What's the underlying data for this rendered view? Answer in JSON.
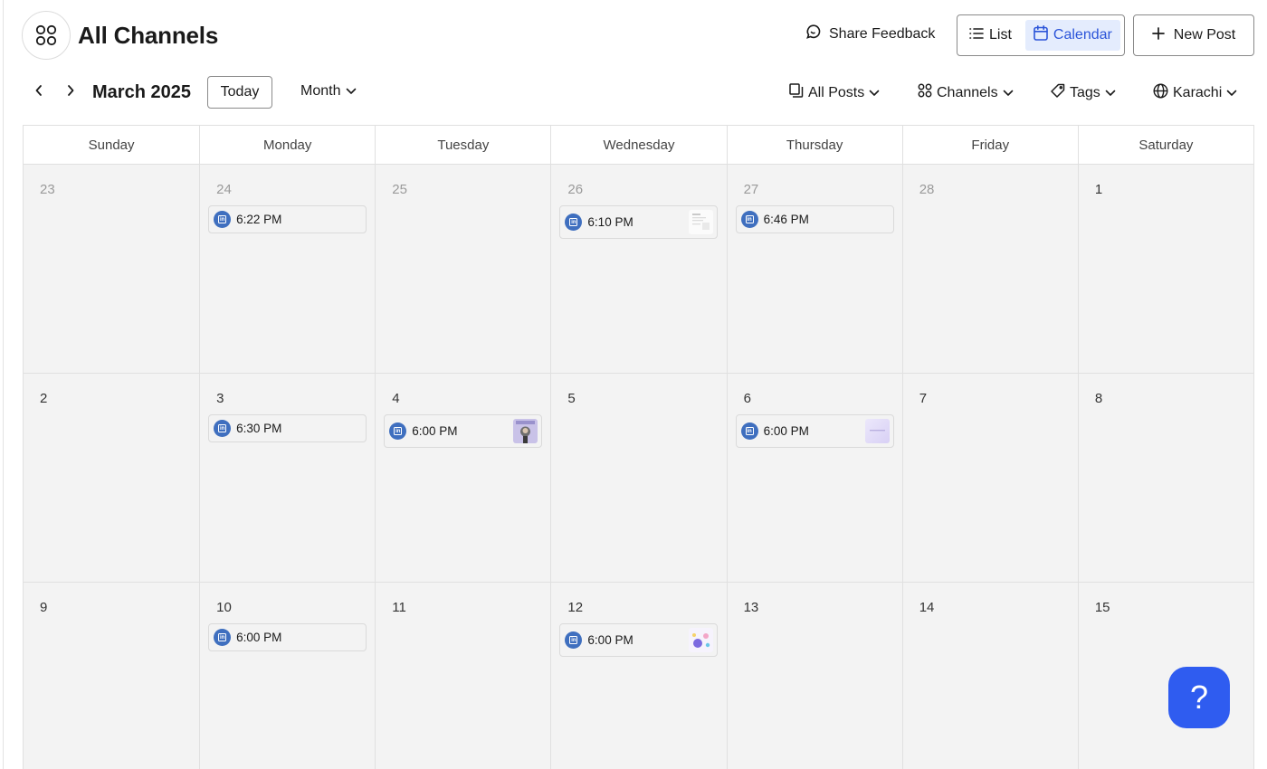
{
  "header": {
    "title": "All Channels",
    "app_icon": "channels-grid-icon",
    "share_feedback": "Share Feedback",
    "view_list": "List",
    "view_calendar": "Calendar",
    "active_view": "Calendar",
    "new_post": "New Post"
  },
  "toolbar": {
    "month_label": "March 2025",
    "today": "Today",
    "view_mode": "Month",
    "filter_posts": "All Posts",
    "filter_channels": "Channels",
    "filter_tags": "Tags",
    "timezone": "Karachi"
  },
  "calendar": {
    "weekdays": [
      "Sunday",
      "Monday",
      "Tuesday",
      "Wednesday",
      "Thursday",
      "Friday",
      "Saturday"
    ],
    "weeks": [
      [
        {
          "day": "23",
          "other": true,
          "posts": []
        },
        {
          "day": "24",
          "other": true,
          "posts": [
            {
              "time": "6:22 PM",
              "channel": "linkedin",
              "thumb": false
            }
          ]
        },
        {
          "day": "25",
          "other": true,
          "posts": []
        },
        {
          "day": "26",
          "other": true,
          "posts": [
            {
              "time": "6:10 PM",
              "channel": "linkedin",
              "thumb": "doc"
            }
          ]
        },
        {
          "day": "27",
          "other": true,
          "posts": [
            {
              "time": "6:46 PM",
              "channel": "linkedin",
              "thumb": false
            }
          ]
        },
        {
          "day": "28",
          "other": true,
          "posts": []
        },
        {
          "day": "1",
          "other": false,
          "posts": []
        }
      ],
      [
        {
          "day": "2",
          "other": false,
          "posts": []
        },
        {
          "day": "3",
          "other": false,
          "posts": [
            {
              "time": "6:30 PM",
              "channel": "linkedin",
              "thumb": false
            }
          ]
        },
        {
          "day": "4",
          "other": false,
          "posts": [
            {
              "time": "6:00 PM",
              "channel": "linkedin",
              "thumb": "person"
            }
          ]
        },
        {
          "day": "5",
          "other": false,
          "posts": []
        },
        {
          "day": "6",
          "other": false,
          "posts": [
            {
              "time": "6:00 PM",
              "channel": "linkedin",
              "thumb": "gradient"
            }
          ]
        },
        {
          "day": "7",
          "other": false,
          "posts": []
        },
        {
          "day": "8",
          "other": false,
          "posts": []
        }
      ],
      [
        {
          "day": "9",
          "other": false,
          "posts": []
        },
        {
          "day": "10",
          "other": false,
          "posts": [
            {
              "time": "6:00 PM",
              "channel": "linkedin",
              "thumb": false
            }
          ]
        },
        {
          "day": "11",
          "other": false,
          "posts": []
        },
        {
          "day": "12",
          "other": false,
          "posts": [
            {
              "time": "6:00 PM",
              "channel": "linkedin",
              "thumb": "colorful"
            }
          ]
        },
        {
          "day": "13",
          "other": false,
          "posts": []
        },
        {
          "day": "14",
          "other": false,
          "posts": []
        },
        {
          "day": "15",
          "other": false,
          "posts": []
        }
      ]
    ]
  },
  "help": {
    "label": "?",
    "icon": "help-icon"
  },
  "colors": {
    "accent": "#2f5cf0",
    "linkedin": "#3f6fbf",
    "active_view_bg": "#e4ecfd",
    "cell_bg": "#f3f3f3"
  }
}
